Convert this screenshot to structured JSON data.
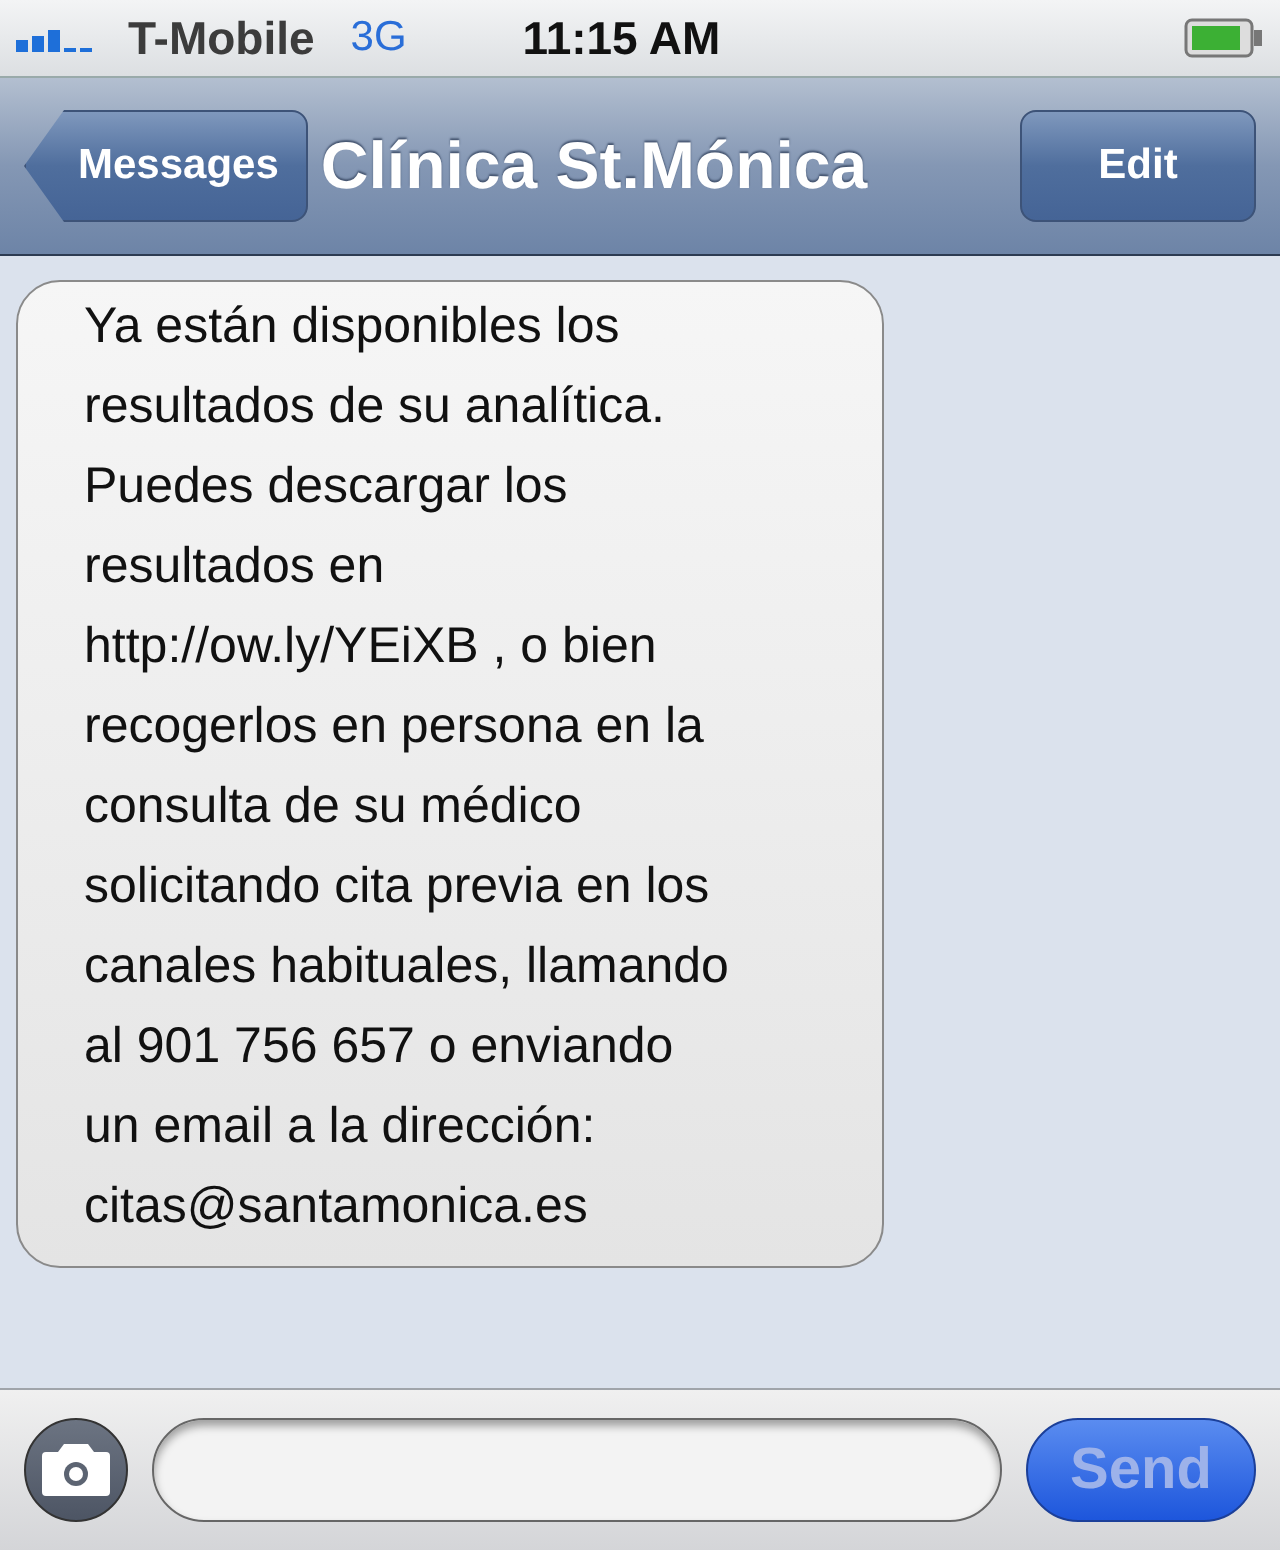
{
  "status_bar": {
    "carrier": "T-Mobile",
    "network": "3G",
    "time": "11:15 AM"
  },
  "nav_bar": {
    "back": "Messages",
    "title": "Clínica St.Mónica",
    "action": "Edit"
  },
  "messages": [
    {
      "kind": "incoming",
      "text": "Ya están disponibles los\nresultados de su analítica.\nPuedes descargar los\nresultados en\nhttp://ow.ly/YEiXB , o bien\nrecogerlos en persona en la\nconsulta de su médico\nsolicitando cita previa en los\ncanales habituales, llamando\nal 901 756 657 o enviando\nun email a la dirección:\ncitas@santamonica.es"
    }
  ],
  "compose": {
    "send": "Send",
    "send_disabled": true
  }
}
